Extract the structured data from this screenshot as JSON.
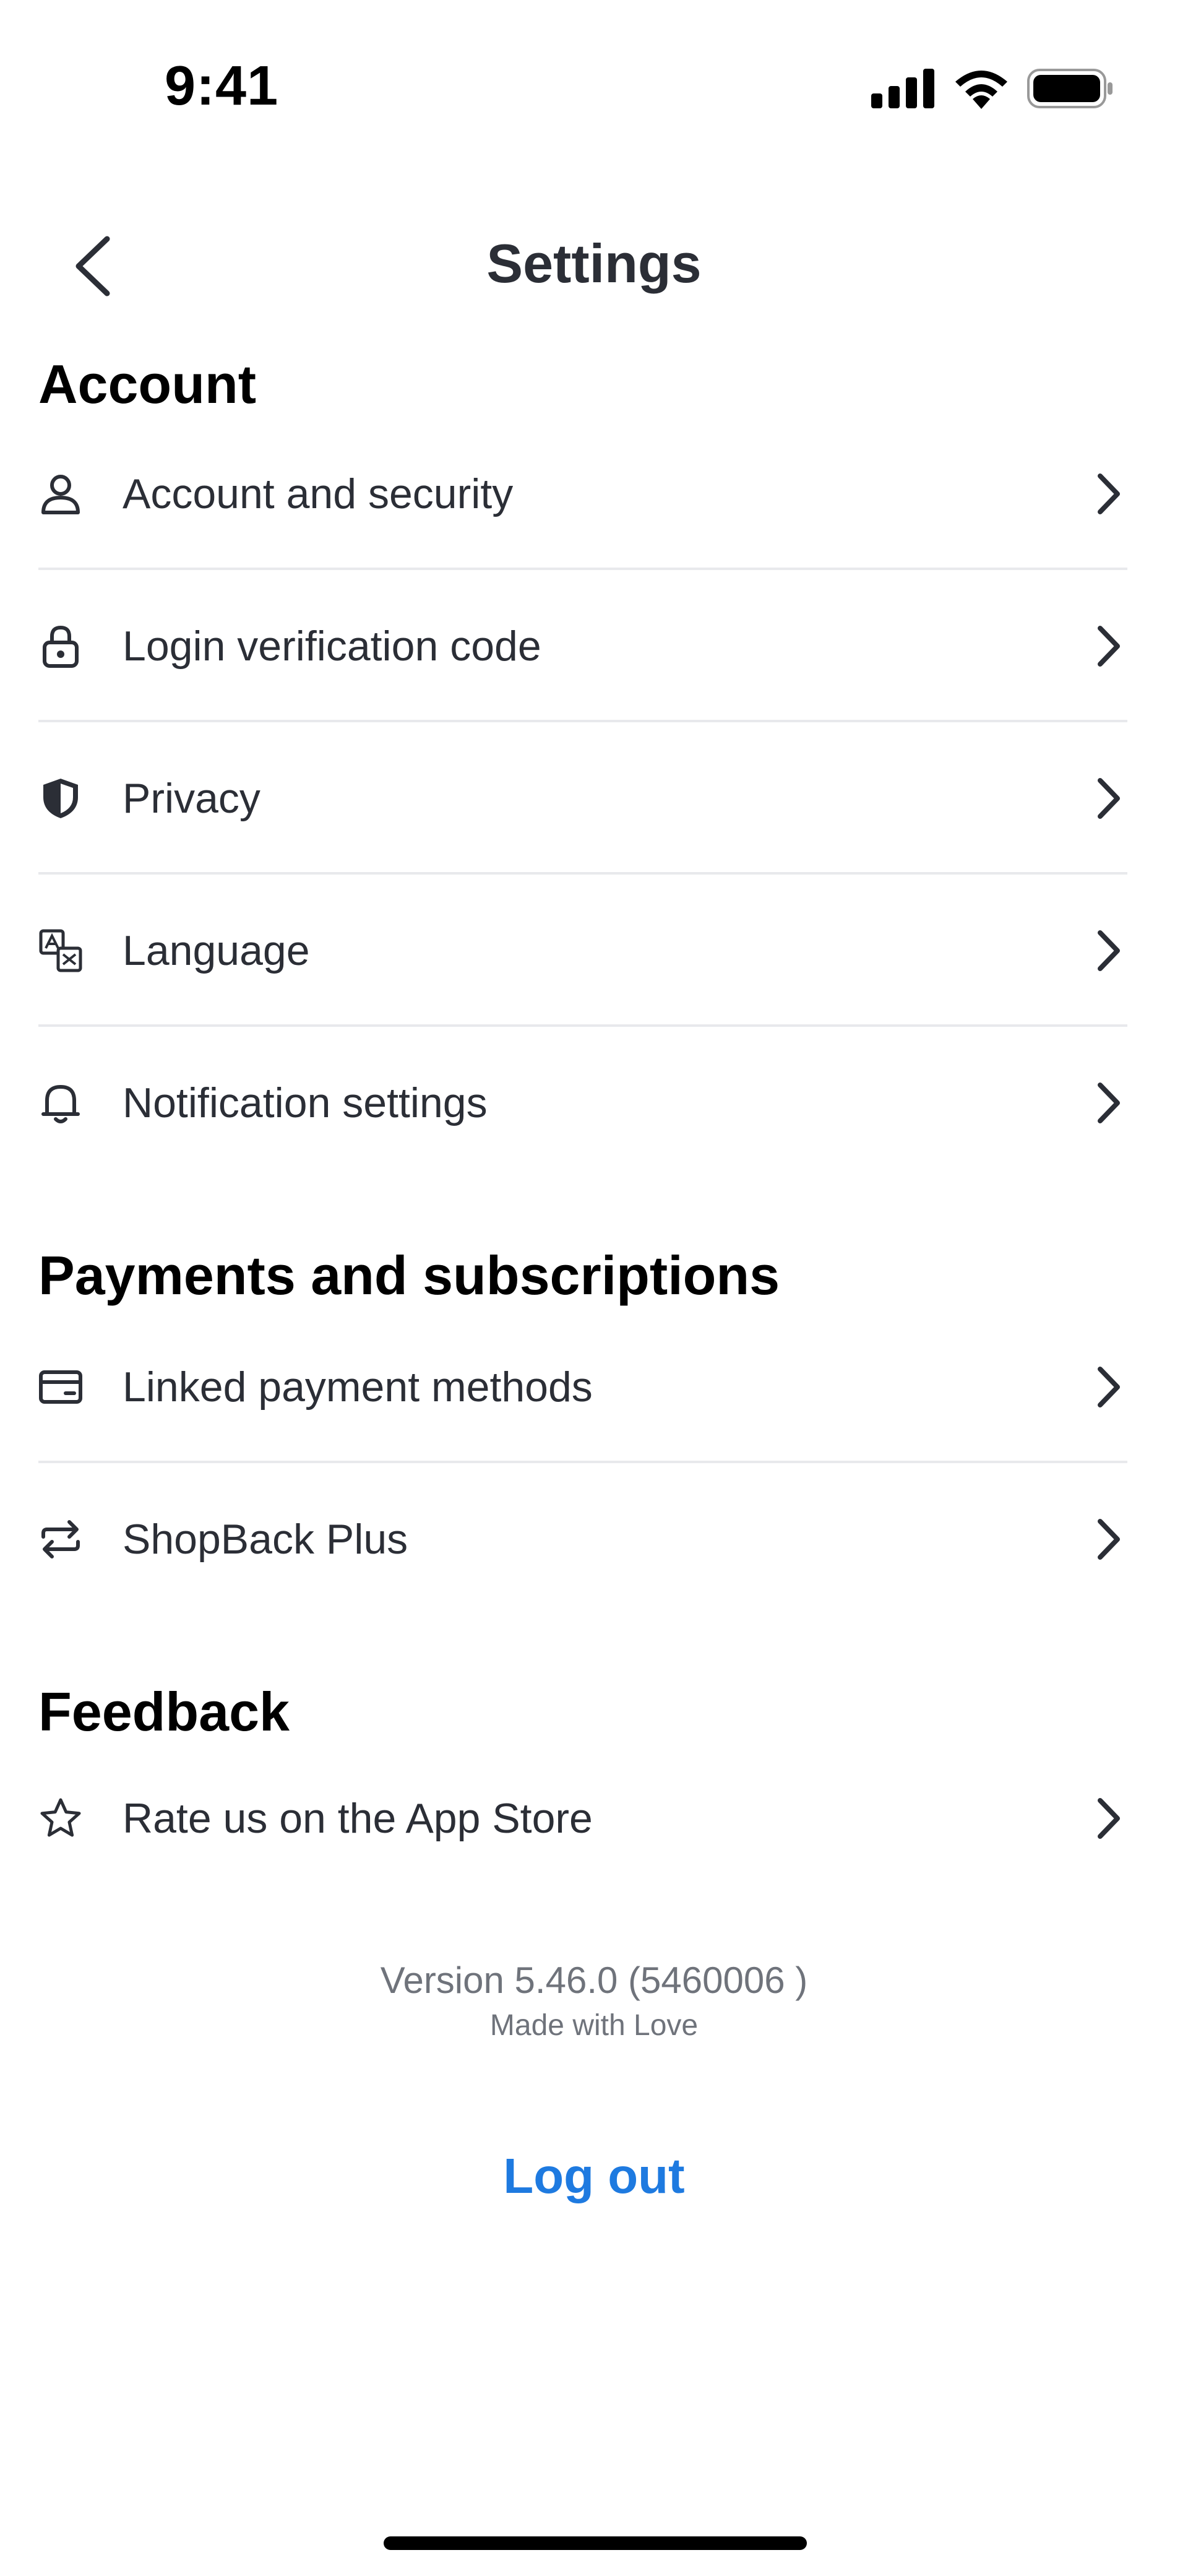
{
  "status_bar": {
    "time": "9:41"
  },
  "nav": {
    "title": "Settings"
  },
  "sections": {
    "account": {
      "title": "Account",
      "items": [
        {
          "label": "Account and security",
          "icon": "person-icon"
        },
        {
          "label": "Login verification code",
          "icon": "lock-icon"
        },
        {
          "label": "Privacy",
          "icon": "shield-icon"
        },
        {
          "label": "Language",
          "icon": "translate-icon"
        },
        {
          "label": "Notification settings",
          "icon": "bell-icon"
        }
      ]
    },
    "payments": {
      "title": "Payments and subscriptions",
      "items": [
        {
          "label": "Linked payment methods",
          "icon": "card-icon"
        },
        {
          "label": "ShopBack Plus",
          "icon": "repeat-icon"
        }
      ]
    },
    "feedback": {
      "title": "Feedback",
      "items": [
        {
          "label": "Rate us on the App Store",
          "icon": "star-icon"
        }
      ]
    }
  },
  "footer": {
    "version": "Version 5.46.0 (5460006 )",
    "made_with": "Made with Love",
    "logout_label": "Log out"
  },
  "colors": {
    "text": "#2b2e36",
    "muted": "#6f737b",
    "divider": "#e8e9ec",
    "link": "#1e7ae0"
  }
}
